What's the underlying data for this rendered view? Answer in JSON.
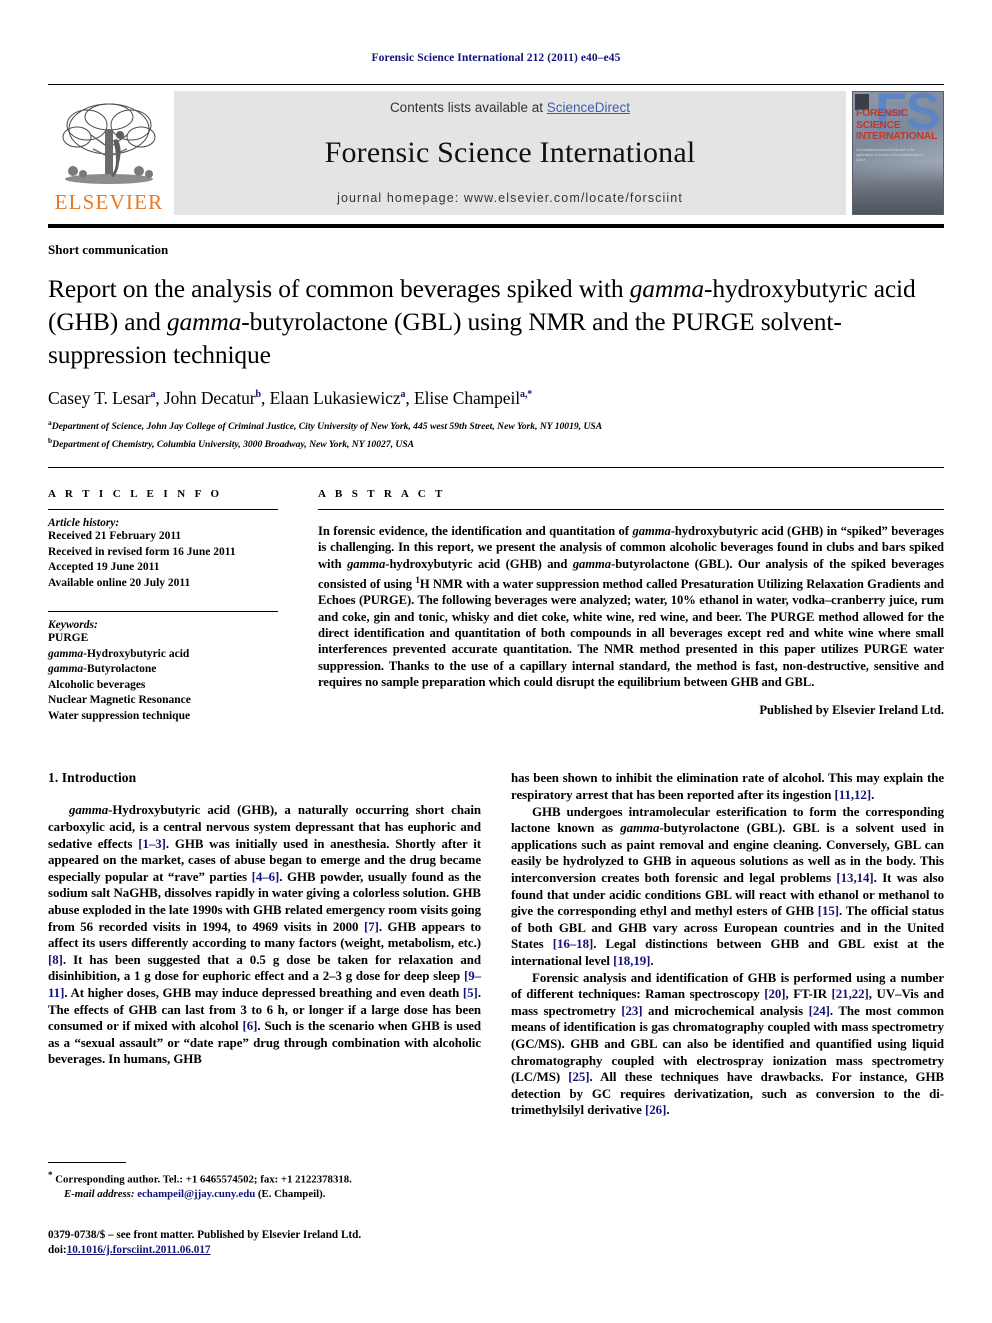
{
  "running_head": "Forensic Science International 212 (2011) e40–e45",
  "banner": {
    "contents_prefix": "Contents lists available at ",
    "sciencedirect": "ScienceDirect",
    "journal_name": "Forensic Science International",
    "homepage": "journal homepage: www.elsevier.com/locate/forsciint",
    "publisher_logo_text": "ELSEVIER",
    "cover": {
      "fsi": "FSI",
      "line1": "FORENSIC",
      "line2": "SCIENCE",
      "line3": "INTERNATIONAL",
      "subtitle": "An international journal dedicated to the applications of science to the administration of justice"
    }
  },
  "article": {
    "doc_type": "Short communication",
    "title_part1": "Report on the analysis of common beverages spiked with ",
    "title_italic1": "gamma",
    "title_part2": "-hydroxybutyric acid (GHB) and ",
    "title_italic2": "gamma",
    "title_part3": "-butyrolactone (GBL) using NMR and the PURGE solvent-suppression technique",
    "authors": [
      {
        "name": "Casey T. Lesar",
        "marks": "a"
      },
      {
        "name": "John Decatur",
        "marks": "b"
      },
      {
        "name": "Elaan Lukasiewicz",
        "marks": "a"
      },
      {
        "name": "Elise Champeil",
        "marks": "a,*"
      }
    ],
    "affiliations": [
      {
        "mark": "a",
        "text": "Department of Science, John Jay College of Criminal Justice, City University of New York, 445 west 59th Street, New York, NY 10019, USA"
      },
      {
        "mark": "b",
        "text": "Department of Chemistry, Columbia University, 3000 Broadway, New York, NY 10027, USA"
      }
    ]
  },
  "article_info": {
    "label": "A R T I C L E  I N F O",
    "history_head": "Article history:",
    "history": [
      "Received 21 February 2011",
      "Received in revised form 16 June 2011",
      "Accepted 19 June 2011",
      "Available online 20 July 2011"
    ],
    "keywords_head": "Keywords:",
    "keywords": [
      {
        "italic": "",
        "text": "PURGE"
      },
      {
        "italic": "gamma",
        "text": "-Hydroxybutyric acid"
      },
      {
        "italic": "gamma",
        "text": "-Butyrolactone"
      },
      {
        "italic": "",
        "text": "Alcoholic beverages"
      },
      {
        "italic": "",
        "text": "Nuclear Magnetic Resonance"
      },
      {
        "italic": "",
        "text": "Water suppression technique"
      }
    ]
  },
  "abstract": {
    "label": "A B S T R A C T",
    "p1_a": "In forensic evidence, the identification and quantitation of ",
    "p1_i1": "gamma",
    "p1_b": "-hydroxybutyric acid (GHB) in “spiked” beverages is challenging. In this report, we present the analysis of common alcoholic beverages found in clubs and bars spiked with ",
    "p1_i2": "gamma",
    "p1_c": "-hydroxybutyric acid (GHB) and ",
    "p1_i3": "gamma",
    "p1_d": "-butyrolactone (GBL). Our analysis of the spiked beverages consisted of using ",
    "p1_sup": "1",
    "p1_e": "H NMR with a water suppression method called Presaturation Utilizing Relaxation Gradients and Echoes (PURGE). The following beverages were analyzed; water, 10% ethanol in water, vodka–cranberry juice, rum and coke, gin and tonic, whisky and diet coke, white wine, red wine, and beer. The PURGE method allowed for the direct identification and quantitation of both compounds in all beverages except red and white wine where small interferences prevented accurate quantitation. The NMR method presented in this paper utilizes PURGE water suppression. Thanks to the use of a capillary internal standard, the method is fast, non-destructive, sensitive and requires no sample preparation which could disrupt the equilibrium between GHB and GBL.",
    "published_by": "Published by Elsevier Ireland Ltd."
  },
  "intro": {
    "heading": "1. Introduction",
    "left": {
      "p1_i": "gamma",
      "p1_a": "-Hydroxybutyric acid (GHB), a naturally occurring short chain carboxylic acid, is a central nervous system depressant that has euphoric and sedative effects ",
      "p1_r1": "[1–3]",
      "p1_b": ". GHB was initially used in anesthesia. Shortly after it appeared on the market, cases of abuse began to emerge and the drug became especially popular at “rave” parties ",
      "p1_r2": "[4–6]",
      "p1_c": ". GHB powder, usually found as the sodium salt NaGHB, dissolves rapidly in water giving a colorless solution. GHB abuse exploded in the late 1990s with GHB related emergency room visits going from 56 recorded visits in 1994, to 4969 visits in 2000 ",
      "p1_r3": "[7]",
      "p1_d": ". GHB appears to affect its users differently according to many factors (weight, metabolism, etc.) ",
      "p1_r4": "[8]",
      "p1_e": ". It has been suggested that a 0.5 g dose be taken for relaxation and disinhibition, a 1 g dose for euphoric effect and a 2–3 g dose for deep sleep ",
      "p1_r5": "[9–11]",
      "p1_f": ". At higher doses, GHB may induce depressed breathing and even death ",
      "p1_r6": "[5]",
      "p1_g": ". The effects of GHB can last from 3 to 6 h, or longer if a large dose has been consumed or if mixed with alcohol ",
      "p1_r7": "[6]",
      "p1_h": ". Such is the scenario when GHB is used as a “sexual assault” or “date rape” drug through combination with alcoholic beverages. In humans, GHB"
    },
    "right": {
      "p1_a": "has been shown to inhibit the elimination rate of alcohol. This may explain the respiratory arrest that has been reported after its ingestion ",
      "p1_r1": "[11,12]",
      "p1_b": ".",
      "p2_a": "GHB undergoes intramolecular esterification to form the corresponding lactone known as ",
      "p2_i1": "gamma",
      "p2_b": "-butyrolactone (GBL). GBL is a solvent used in applications such as paint removal and engine cleaning. Conversely, GBL can easily be hydrolyzed to GHB in aqueous solutions as well as in the body. This interconversion creates both forensic and legal problems ",
      "p2_r1": "[13,14]",
      "p2_c": ". It was also found that under acidic conditions GBL will react with ethanol or methanol to give the corresponding ethyl and methyl esters of GHB ",
      "p2_r2": "[15]",
      "p2_d": ". The official status of both GBL and GHB vary across European countries and in the United States ",
      "p2_r3": "[16–18]",
      "p2_e": ". Legal distinctions between GHB and GBL exist at the international level ",
      "p2_r4": "[18,19]",
      "p2_f": ".",
      "p3_a": "Forensic analysis and identification of GHB is performed using a number of different techniques: Raman spectroscopy ",
      "p3_r1": "[20]",
      "p3_b": ", FT-IR ",
      "p3_r2": "[21,22]",
      "p3_c": ", UV–Vis and mass spectrometry ",
      "p3_r3": "[23]",
      "p3_d": " and microchemical analysis ",
      "p3_r4": "[24]",
      "p3_e": ". The most common means of identification is gas chromatography coupled with mass spectrometry (GC/MS). GHB and GBL can also be identified and quantified using liquid chromatography coupled with electrospray ionization mass spectrometry (LC/MS) ",
      "p3_r5": "[25]",
      "p3_f": ". All these techniques have drawbacks. For instance, GHB detection by GC requires derivatization, such as conversion to the di-trimethylsilyl derivative ",
      "p3_r6": "[26]",
      "p3_g": "."
    }
  },
  "footnote": {
    "marker": "*",
    "corresponding": "Corresponding author. Tel.: +1 6465574502; fax: +1 2122378318.",
    "email_label": "E-mail address:",
    "email": "echampeil@jjay.cuny.edu",
    "email_owner": "(E. Champeil)."
  },
  "footer": {
    "issn_line": "0379-0738/$ – see front matter. Published by Elsevier Ireland Ltd.",
    "doi_prefix": "doi:",
    "doi": "10.1016/j.forsciint.2011.06.017"
  }
}
